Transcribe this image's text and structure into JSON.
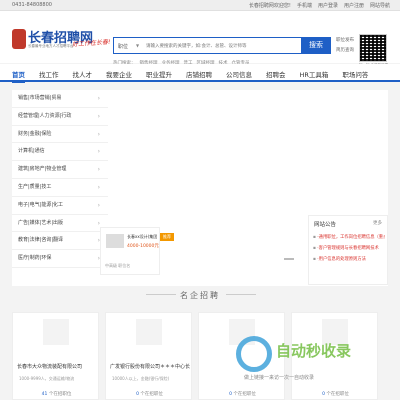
{
  "topbar": {
    "phone": "0431-84808800",
    "links": [
      "长春招聘网欢迎您!",
      "手机端",
      "用户登录",
      "用户注册",
      "网站导航"
    ]
  },
  "logo": {
    "title": "长春招聘网",
    "subtitle": "长春最专业地方人才招聘平台",
    "slogan": "好工作在长春!"
  },
  "search": {
    "type_label": "职位",
    "placeholder": "请输入要搜索的关键字，如:会计、总管、设计师等",
    "button_label": "搜索"
  },
  "hot_words": {
    "label": "热门搜索：",
    "items": [
      "销售经理",
      "业务经理",
      "普工",
      "区域经理",
      "技术",
      "仓管专员"
    ]
  },
  "header_links": [
    "职位发布",
    "简历查询"
  ],
  "qr_caption": "扫一扫 手机随时看",
  "nav": {
    "items": [
      "首页",
      "找工作",
      "找人才",
      "我要企业",
      "职业提升",
      "店铺招聘",
      "公司信息",
      "招聘会",
      "HR工具箱",
      "职场问答"
    ]
  },
  "categories": [
    "销售|市场营销|贸易",
    "经营管理|人力资源|行政",
    "财务|金融|保险",
    "计算机|通信",
    "建筑|房地产|物业管理",
    "生产|质量|技工",
    "电子|电气|能源|化工",
    "广告|媒体|艺术|出版",
    "教育|法律|咨询|翻译",
    "医疗|制药|环保"
  ],
  "ad": {
    "company": "长春xx设计(集团",
    "salary": "4000-10000元",
    "more": "中高级 职位名",
    "tag": "推荐"
  },
  "side_box": {
    "title": "网站公告",
    "more": "更多",
    "items": [
      "·通用职位，工作岗位招聘信息（重点",
      "·客户管理规则与长春招聘网技术",
      "·用户信息的处理原则方法"
    ]
  },
  "section_title": "名企招聘",
  "companies": [
    {
      "name": "长春市大众物流装配有限公司",
      "info": "1000-9999人，交通运输/物流",
      "jobs_count": "41",
      "jobs_label": "个在招职位"
    },
    {
      "name": "广发银行股份有限公司＊＊＊中心长",
      "info": "10000人以上，金融(银行/保险)",
      "jobs_count": "0",
      "jobs_label": "个在招职位"
    },
    {
      "name": "",
      "info": "",
      "jobs_count": "0",
      "jobs_label": "个在招职位"
    },
    {
      "name": "",
      "info": "",
      "jobs_count": "0",
      "jobs_label": "个在招职位"
    }
  ],
  "watermark": {
    "text": "自动秒收录",
    "sub": "做上链接一来访一次一自动收录"
  }
}
